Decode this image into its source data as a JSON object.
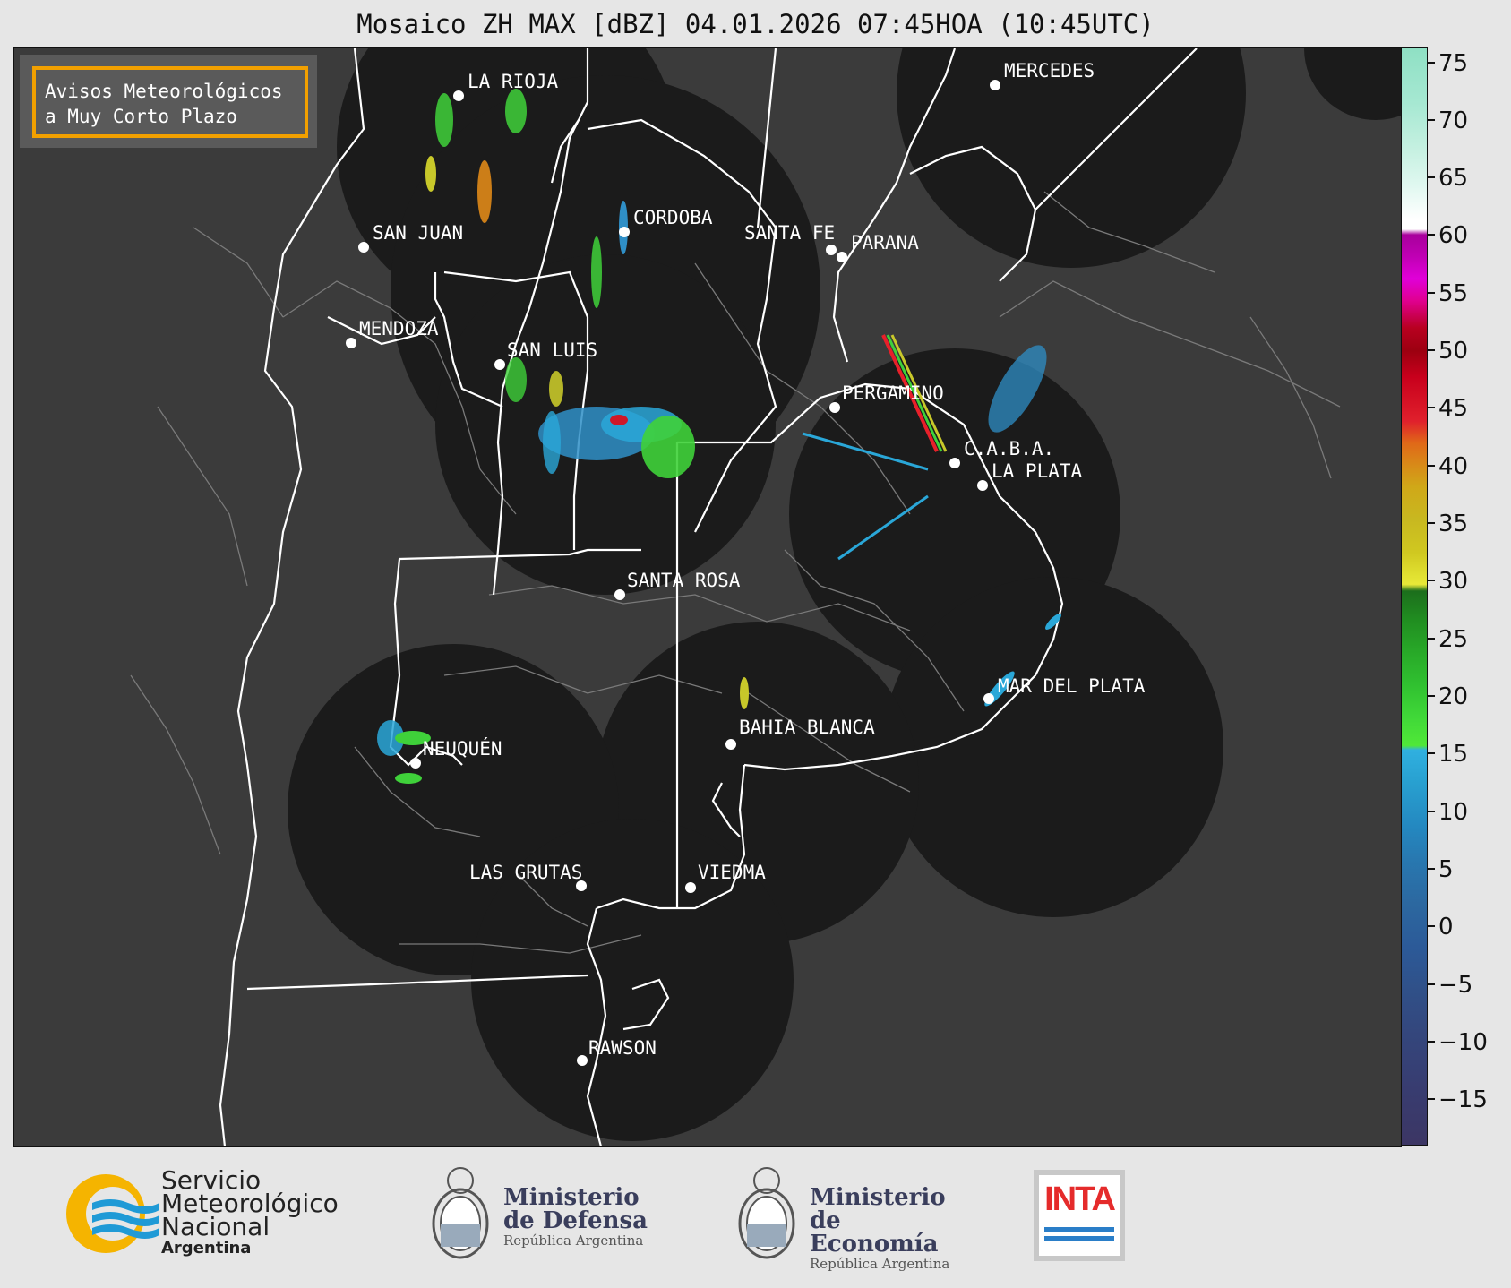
{
  "title": "Mosaico ZH MAX [dBZ] 04.01.2026 07:45HOA (10:45UTC)",
  "badge": {
    "line1": "Avisos Meteorológicos",
    "line2": "a Muy Corto Plazo"
  },
  "cities": [
    {
      "name": "LA RIOJA"
    },
    {
      "name": "MERCEDES"
    },
    {
      "name": "SAN JUAN"
    },
    {
      "name": "CORDOBA"
    },
    {
      "name": "SANTA FE"
    },
    {
      "name": "PARANA"
    },
    {
      "name": "MENDOZA"
    },
    {
      "name": "SAN LUIS"
    },
    {
      "name": "PERGAMINO"
    },
    {
      "name": "C.A.B.A."
    },
    {
      "name": "LA PLATA"
    },
    {
      "name": "SANTA ROSA"
    },
    {
      "name": "MAR DEL PLATA"
    },
    {
      "name": "BAHIA BLANCA"
    },
    {
      "name": "NEUQUÉN"
    },
    {
      "name": "LAS GRUTAS"
    },
    {
      "name": "VIEDMA"
    },
    {
      "name": "RAWSON"
    }
  ],
  "colorbar": {
    "unit": "dBZ",
    "ticks": [
      "75",
      "70",
      "65",
      "60",
      "55",
      "50",
      "45",
      "40",
      "35",
      "30",
      "25",
      "20",
      "15",
      "10",
      "5",
      "0",
      "−5",
      "−10",
      "−15"
    ],
    "min": -19,
    "max": 77
  },
  "footer": {
    "smn_line1": "Servicio",
    "smn_line2": "Meteorológico",
    "smn_line3": "Nacional",
    "smn_sub": "Argentina",
    "def_line1": "Ministerio",
    "def_line2": "de Defensa",
    "def_sub": "República Argentina",
    "eco_line1": "Ministerio",
    "eco_line2": "de Economía",
    "eco_sub": "República Argentina",
    "inta": "INTA"
  },
  "colors": {
    "radar_coverage": "#1b1b1b",
    "background": "#3b3b3b",
    "border_white": "#ffffff",
    "badge_border": "#f2a000"
  }
}
